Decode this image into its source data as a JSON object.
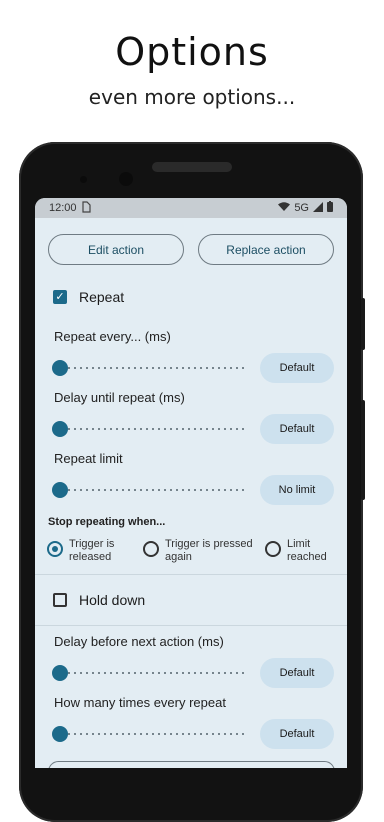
{
  "hero": {
    "title": "Options",
    "subtitle": "even more options..."
  },
  "status_bar": {
    "time": "12:00",
    "network": "5G"
  },
  "actions": {
    "edit_label": "Edit action",
    "replace_label": "Replace action"
  },
  "repeat": {
    "label": "Repeat",
    "checked": true
  },
  "settings": [
    {
      "label": "Repeat every... (ms)",
      "button": "Default",
      "value": 0
    },
    {
      "label": "Delay until repeat (ms)",
      "button": "Default",
      "value": 0
    },
    {
      "label": "Repeat limit",
      "button": "No limit",
      "value": 0
    }
  ],
  "stop_repeating": {
    "heading": "Stop repeating when...",
    "options": [
      {
        "line1": "Trigger is",
        "line2": "released",
        "selected": true
      },
      {
        "line1": "Trigger is pressed",
        "line2": "again",
        "selected": false
      },
      {
        "line1": "Limit",
        "line2": "reached",
        "selected": false
      }
    ]
  },
  "hold_down": {
    "label": "Hold down",
    "checked": false
  },
  "more_settings": [
    {
      "label": "Delay before next action (ms)",
      "button": "Default",
      "value": 0
    },
    {
      "label": "How many times every repeat",
      "button": "Default",
      "value": 0
    }
  ],
  "colors": {
    "accent": "#1c6a8a",
    "screen_bg": "#e3edf3",
    "pill_bg": "#cde1ee"
  }
}
